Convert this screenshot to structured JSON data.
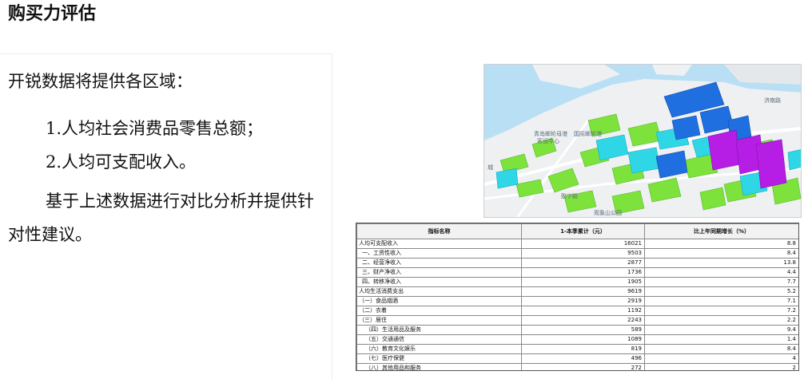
{
  "title": "购买力评估",
  "left": {
    "intro": "开锐数据将提供各区域：",
    "items": [
      "1.人均社会消费品零售总额；",
      "2.人均可支配收入。"
    ],
    "paragraph": "基于上述数据进行对比分析并提供针对性建议。"
  },
  "map": {
    "labels": [
      "青岛邮轮母港",
      "客运中心",
      "国际邮轮港",
      "济南路",
      "城",
      "观象山公园",
      "胶宁路"
    ],
    "colors": {
      "water": "#b9dff5",
      "land": "#eef0f2",
      "green": "#7ee23c",
      "cyan": "#2fd7e6",
      "blue": "#1f6fe0",
      "purple": "#b61ee6"
    }
  },
  "table": {
    "headers": [
      "指标名称",
      "1-本季累计（元）",
      "比上年同期增长（%）"
    ],
    "rows": [
      {
        "name": "人均可支配收入",
        "value": "16021",
        "growth": "8.8",
        "level": 0
      },
      {
        "name": "一、工资性收入",
        "value": "9503",
        "growth": "8.4",
        "level": 1
      },
      {
        "name": "二、经营净收入",
        "value": "2877",
        "growth": "13.8",
        "level": 1
      },
      {
        "name": "三、财产净收入",
        "value": "1736",
        "growth": "4.4",
        "level": 1
      },
      {
        "name": "四、转移净收入",
        "value": "1905",
        "growth": "7.7",
        "level": 1
      },
      {
        "name": "人均生活消费支出",
        "value": "9619",
        "growth": "5.2",
        "level": 0
      },
      {
        "name": "（一）食品烟酒",
        "value": "2919",
        "growth": "7.1",
        "level": 0
      },
      {
        "name": "（二）衣着",
        "value": "1192",
        "growth": "7.2",
        "level": 0
      },
      {
        "name": "（三）居住",
        "value": "2243",
        "growth": "2.2",
        "level": 0
      },
      {
        "name": "（四）生活用品及服务",
        "value": "589",
        "growth": "9.4",
        "level": 2
      },
      {
        "name": "（五）交通通信",
        "value": "1089",
        "growth": "1.4",
        "level": 2
      },
      {
        "name": "（六）教育文化娱乐",
        "value": "819",
        "growth": "8.4",
        "level": 2
      },
      {
        "name": "（七）医疗保健",
        "value": "496",
        "growth": "4",
        "level": 2
      },
      {
        "name": "（八）其他用品和服务",
        "value": "272",
        "growth": "2",
        "level": 2
      }
    ]
  }
}
